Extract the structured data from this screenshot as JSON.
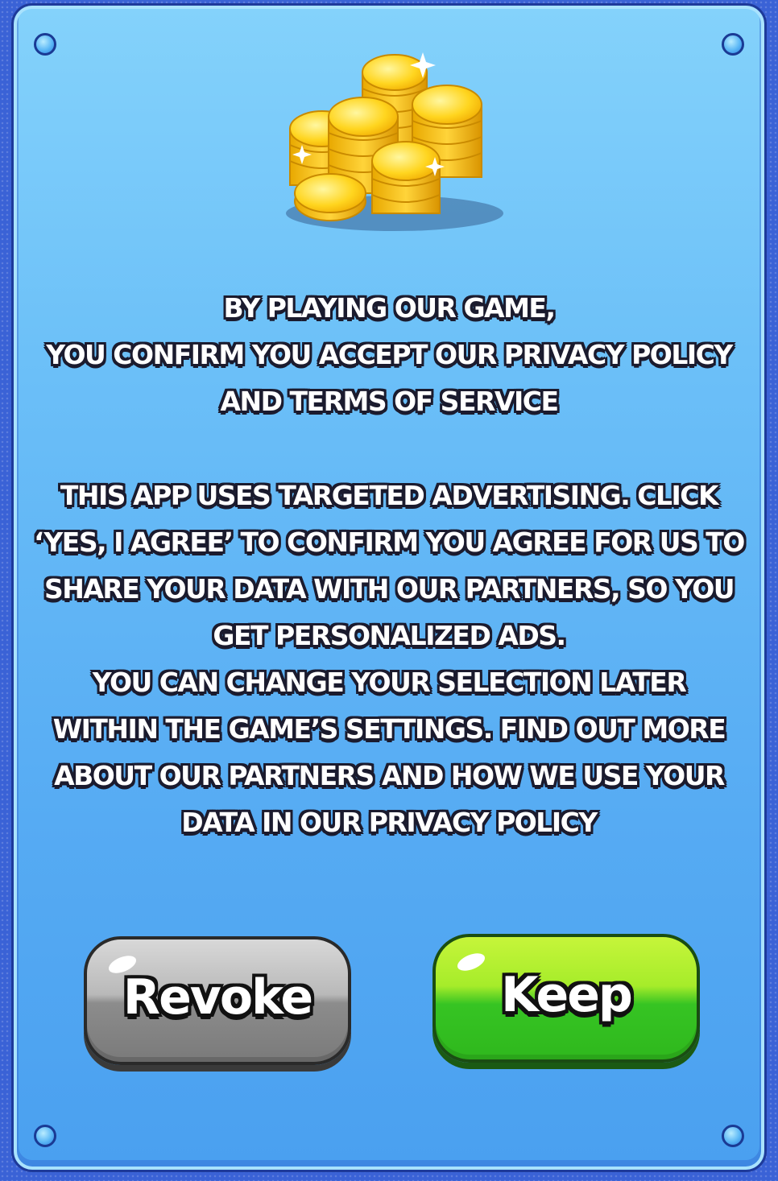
{
  "dialog": {
    "paragraph1": [
      "BY PLAYING OUR GAME,",
      "YOU CONFIRM YOU ACCEPT OUR PRIVACY POLICY",
      "AND TERMS OF SERVICE"
    ],
    "paragraph2": [
      "THIS APP USES TARGETED ADVERTISING. CLICK",
      "‘YES, I AGREE’ TO CONFIRM YOU AGREE FOR US TO",
      "SHARE YOUR DATA WITH OUR PARTNERS, SO YOU",
      "GET PERSONALIZED ADS.",
      "YOU CAN CHANGE YOUR SELECTION LATER",
      "WITHIN THE GAME’S SETTINGS. FIND OUT MORE",
      "ABOUT OUR PARTNERS AND HOW WE USE YOUR",
      "DATA IN OUR PRIVACY POLICY"
    ],
    "icon": "gold-coins-icon"
  },
  "buttons": {
    "revoke_label": "Revoke",
    "keep_label": "Keep"
  },
  "colors": {
    "panel_top": "#84d2fb",
    "panel_bottom": "#4aa0f0",
    "revoke": "#8c8c8c",
    "keep": "#2fb81d"
  }
}
